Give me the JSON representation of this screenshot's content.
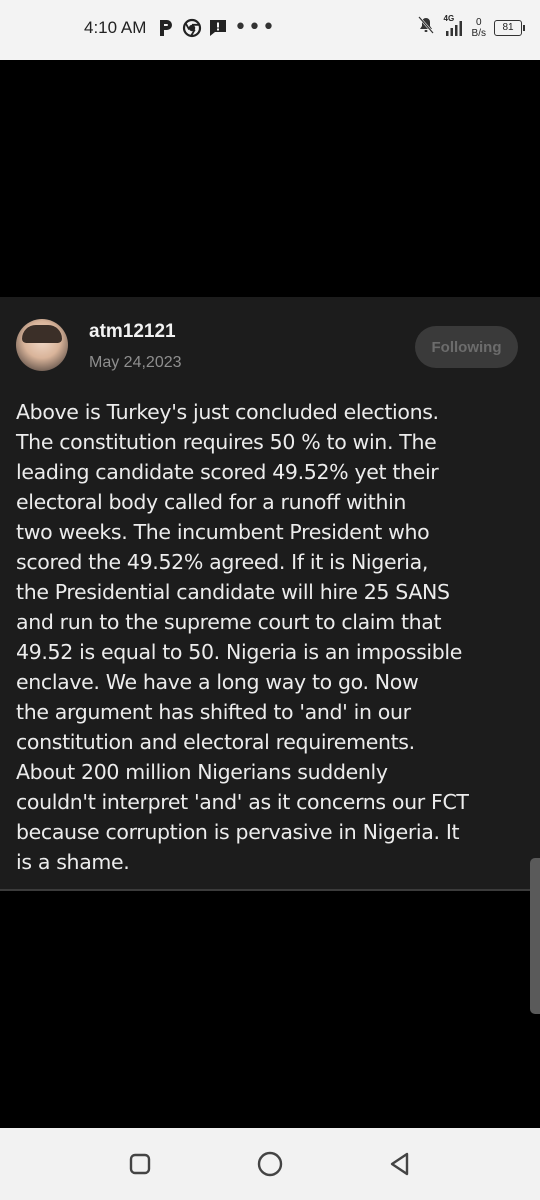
{
  "status_bar": {
    "time": "4:10 AM",
    "left_icons": [
      "p-notification-icon",
      "chrome-icon",
      "alert-message-icon",
      "more-dots-icon"
    ],
    "network_label": "4G",
    "net_speed_value": "0",
    "net_speed_unit": "B/s",
    "battery": "81"
  },
  "post": {
    "username": "atm12121",
    "date": "May 24,2023",
    "follow_label": "Following",
    "body": "Above is Turkey's just concluded elections.\nThe constitution requires 50 % to win. The\nleading candidate scored 49.52% yet their\nelectoral body called for a runoff within\ntwo weeks. The incumbent President who\nscored the 49.52% agreed. If it is Nigeria,\nthe Presidential candidate will hire 25 SANS\nand run to the supreme court to claim that\n49.52 is equal to 50. Nigeria is an impossible\nenclave. We have a long way to go. Now\nthe argument has shifted to 'and' in our\nconstitution and electoral requirements.\nAbout 200 million Nigerians suddenly\ncouldn't interpret 'and' as it concerns our FCT\nbecause corruption is pervasive in Nigeria. It\nis a shame."
  },
  "nav_bar": {
    "buttons": [
      "recents-square-icon",
      "home-circle-icon",
      "back-triangle-icon"
    ]
  },
  "colors": {
    "card_bg": "#1c1c1c",
    "page_bg": "#000000",
    "status_bg": "#f3f3f3",
    "follow_bg": "#3a3a3a"
  }
}
